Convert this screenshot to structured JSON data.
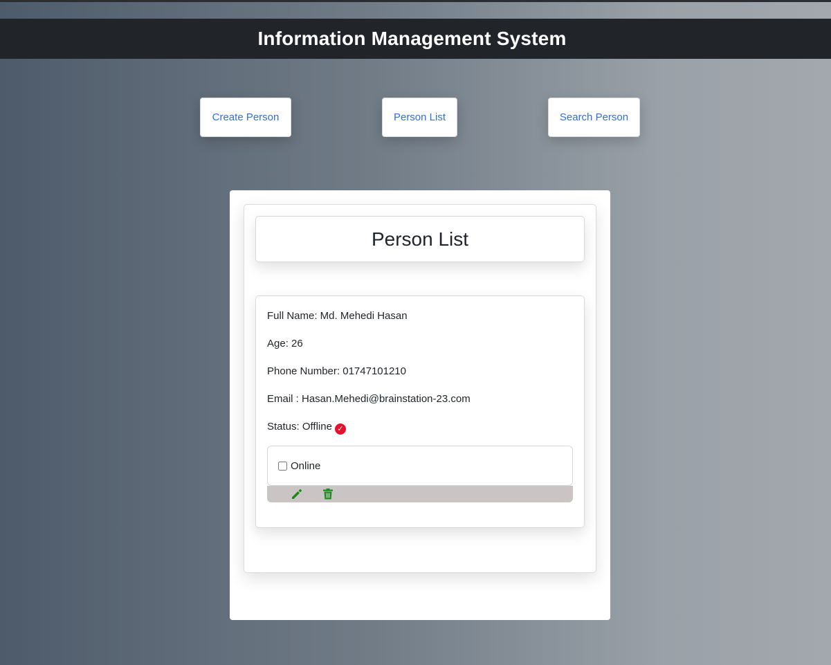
{
  "header": {
    "title": "Information Management System"
  },
  "nav": {
    "create_label": "Create Person",
    "list_label": "Person List",
    "search_label": "Search Person"
  },
  "panel": {
    "title": "Person List"
  },
  "person": {
    "full_name": "Full Name: Md. Mehedi Hasan",
    "age": "Age: 26",
    "phone": "Phone Number: 01747101210",
    "email": "Email : Hasan.Mehedi@brainstation-23.com",
    "status": "Status: Offline",
    "status_icon": "check-circle-icon",
    "online_label": "Online",
    "online_checked": false
  },
  "actions": {
    "edit_icon": "pencil-icon",
    "delete_icon": "trash-icon"
  },
  "colors": {
    "header_bg": "#212529",
    "link": "#2f6fd6",
    "status_icon": "#e8102e",
    "action_icon": "#1a8a1a",
    "action_bar": "#cbc4c4"
  }
}
